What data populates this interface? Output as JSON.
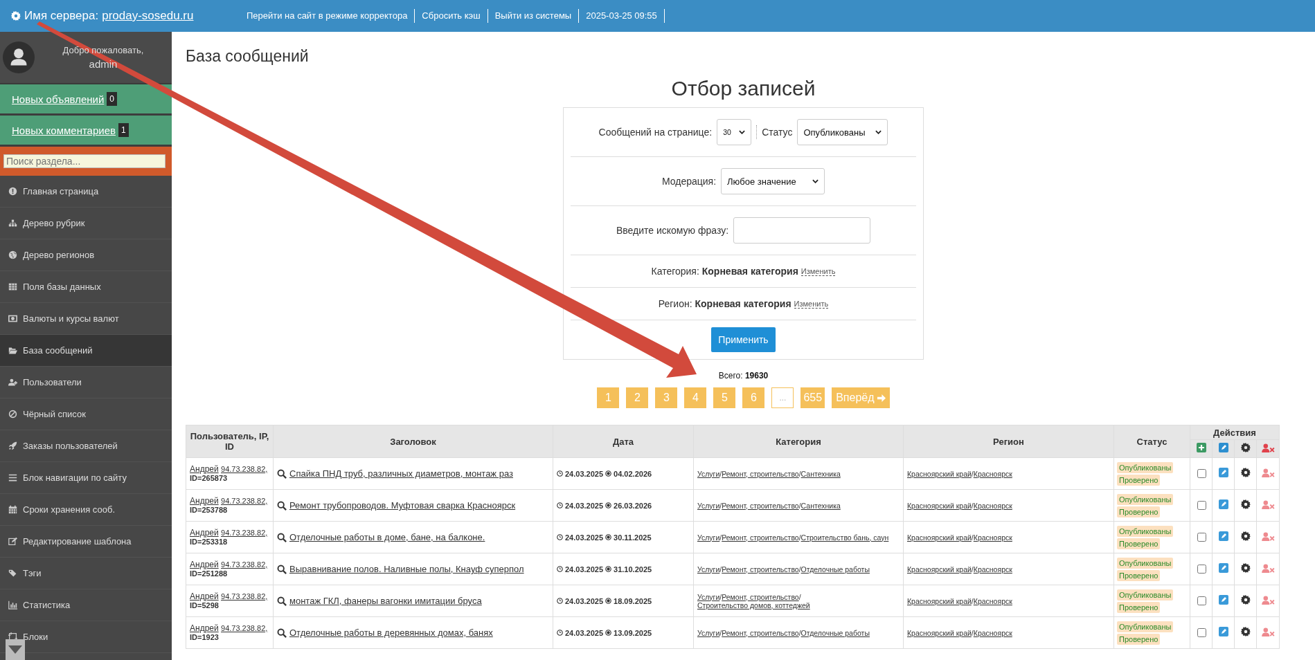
{
  "top_bar": {
    "server_label": "Имя сервера:",
    "server_link": "proday-sosedu.ru",
    "links": [
      "Перейти на сайт в режиме корректора",
      "Сбросить кэш",
      "Выйти из системы"
    ],
    "datetime": "2025-03-25 09:55"
  },
  "sidebar": {
    "welcome": "Добро пожаловать,",
    "username": "admin",
    "counters": [
      {
        "label": "Новых объявлений",
        "count": "0"
      },
      {
        "label": "Новых комментариев",
        "count": "1"
      }
    ],
    "search": {
      "placeholder": "Поиск раздела..."
    },
    "items": [
      {
        "label": "Главная страница",
        "selected": false
      },
      {
        "label": "Дерево рубрик",
        "selected": false
      },
      {
        "label": "Дерево регионов",
        "selected": false
      },
      {
        "label": "Поля базы данных",
        "selected": false
      },
      {
        "label": "Валюты и курсы валют",
        "selected": false
      },
      {
        "label": "База сообщений",
        "selected": true
      },
      {
        "label": "Пользователи",
        "selected": false
      },
      {
        "label": "Чёрный список",
        "selected": false
      },
      {
        "label": "Заказы пользователей",
        "selected": false
      },
      {
        "label": "Блок навигации по сайту",
        "selected": false
      },
      {
        "label": "Сроки хранения сооб.",
        "selected": false
      },
      {
        "label": "Редактирование шаблона",
        "selected": false
      },
      {
        "label": "Тэги",
        "selected": false
      },
      {
        "label": "Статистика",
        "selected": false
      },
      {
        "label": "Блоки",
        "selected": false
      }
    ]
  },
  "page_title": "База сообщений",
  "filter": {
    "title": "Отбор записей",
    "per_page": {
      "label": "Сообщений на странице:",
      "value": "30"
    },
    "status": {
      "label": "Статус",
      "value": "Опубликованы"
    },
    "moderation": {
      "label": "Модерация:",
      "value": "Любое значение"
    },
    "search": {
      "label": "Введите искомую фразу:"
    },
    "category": {
      "label": "Категория:",
      "value": "Корневая категория",
      "link": "Изменить"
    },
    "region": {
      "label": "Регион:",
      "value": "Корневая категория",
      "link": "Изменить"
    },
    "apply_button": "Применить"
  },
  "total": {
    "label": "Всего:",
    "value": "19630"
  },
  "pagination": [
    {
      "label": "1",
      "kind": "page"
    },
    {
      "label": "2",
      "kind": "page"
    },
    {
      "label": "3",
      "kind": "page"
    },
    {
      "label": "4",
      "kind": "page"
    },
    {
      "label": "5",
      "kind": "page"
    },
    {
      "label": "6",
      "kind": "page"
    },
    {
      "label": "...",
      "kind": "ellipsis"
    },
    {
      "label": "655",
      "kind": "page"
    },
    {
      "label": "Вперёд",
      "kind": "next"
    }
  ],
  "table": {
    "separator": "/",
    "columns": [
      "Пользователь, IP, ID",
      "Заголовок",
      "Дата",
      "Категория",
      "Регион",
      "Статус",
      "Действия"
    ],
    "rows": [
      {
        "user": "Андрей",
        "ip": "94.73.238.82,",
        "id": "ID=265873",
        "title": "Спайка ПНД труб, различных диаметров, монтаж раз",
        "date_from": "24.03.2025",
        "date_to": "04.02.2026",
        "category": [
          "Услуги",
          "Ремонт, строительство",
          "Сантехника"
        ],
        "region": [
          "Красноярский край",
          "Красноярск"
        ],
        "status": [
          "Опубликованы",
          "Проверено"
        ],
        "checked": false
      },
      {
        "user": "Андрей",
        "ip": "94.73.238.82,",
        "id": "ID=253788",
        "title": "Ремонт трубопроводов. Муфтовая сварка Красноярск",
        "date_from": "24.03.2025",
        "date_to": "26.03.2026",
        "category": [
          "Услуги",
          "Ремонт, строительство",
          "Сантехника"
        ],
        "region": [
          "Красноярский край",
          "Красноярск"
        ],
        "status": [
          "Опубликованы",
          "Проверено"
        ],
        "checked": false
      },
      {
        "user": "Андрей",
        "ip": "94.73.238.82,",
        "id": "ID=253318",
        "title": "Отделочные работы в доме, бане, на балконе.",
        "date_from": "24.03.2025",
        "date_to": "30.11.2025",
        "category": [
          "Услуги",
          "Ремонт, строительство",
          "Строительство бань, саун"
        ],
        "region": [
          "Красноярский край",
          "Красноярск"
        ],
        "status": [
          "Опубликованы",
          "Проверено"
        ],
        "checked": false
      },
      {
        "user": "Андрей",
        "ip": "94.73.238.82,",
        "id": "ID=251288",
        "title": "Выравнивание полов. Наливные полы, Кнауф суперпол",
        "date_from": "24.03.2025",
        "date_to": "31.10.2025",
        "category": [
          "Услуги",
          "Ремонт, строительство",
          "Отделочные работы"
        ],
        "region": [
          "Красноярский край",
          "Красноярск"
        ],
        "status": [
          "Опубликованы",
          "Проверено"
        ],
        "checked": false
      },
      {
        "user": "Андрей",
        "ip": "94.73.238.82,",
        "id": "ID=5298",
        "title": "монтаж ГКЛ, фанеры вагонки имитации бруса",
        "date_from": "24.03.2025",
        "date_to": "18.09.2025",
        "category": [
          "Услуги",
          "Ремонт, строительство",
          "Строительство домов, коттеджей"
        ],
        "region": [
          "Красноярский край",
          "Красноярск"
        ],
        "status": [
          "Опубликованы",
          "Проверено"
        ],
        "checked": false
      },
      {
        "user": "Андрей",
        "ip": "94.73.238.82,",
        "id": "ID=1923",
        "title": "Отделочные работы в деревянных домах, банях",
        "date_from": "24.03.2025",
        "date_to": "13.09.2025",
        "category": [
          "Услуги",
          "Ремонт, строительство",
          "Отделочные работы"
        ],
        "region": [
          "Красноярский край",
          "Красноярск"
        ],
        "status": [
          "Опубликованы",
          "Проверено"
        ],
        "checked": false
      }
    ]
  }
}
